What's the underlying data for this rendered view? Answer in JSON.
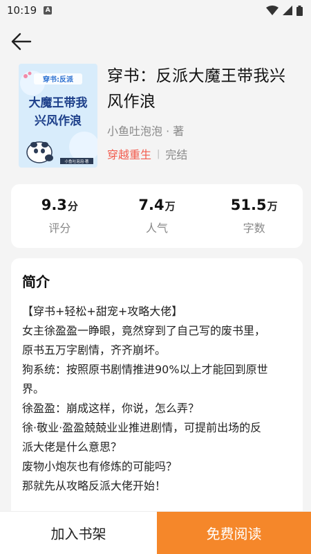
{
  "status_bar": {
    "time": "10:19",
    "notification_badge": "A"
  },
  "book": {
    "title": "穿书：反派大魔王带我兴风作浪",
    "author": "小鱼吐泡泡 · 著",
    "genre_tag": "穿越重生",
    "separator": "|",
    "status_tag": "完结",
    "cover": {
      "top_text": "穿书:反派",
      "main_text_line1": "大魔王带我",
      "main_text_line2": "兴风作浪",
      "author_text": "小鱼吐泡泡·著"
    }
  },
  "stats": [
    {
      "value": "9.3",
      "unit": "分",
      "label": "评分"
    },
    {
      "value": "7.4",
      "unit": "万",
      "label": "人气"
    },
    {
      "value": "51.5",
      "unit": "万",
      "label": "字数"
    }
  ],
  "intro": {
    "heading": "简介",
    "lines": [
      "【穿书+轻松+甜宠+攻略大佬】",
      "女主徐盈盈一睁眼，竟然穿到了自己写的废书里，",
      "原书五万字剧情，齐齐崩坏。",
      "狗系统：按照原书剧情推进90%以上才能回到原世",
      "界。",
      "徐盈盈：崩成这样，你说，怎么弄？",
      "徐·敬业·盈盈兢兢业业推进剧情，可提前出场的反",
      "派大佬是什么意思？",
      "废物小炮灰也有修炼的可能吗？",
      "那就先从攻略反派大佬开始！"
    ]
  },
  "actions": {
    "add_to_shelf": "加入书架",
    "free_read": "免费阅读"
  },
  "colors": {
    "accent_orange": "#f5872a",
    "genre_red": "#f25b4d"
  }
}
